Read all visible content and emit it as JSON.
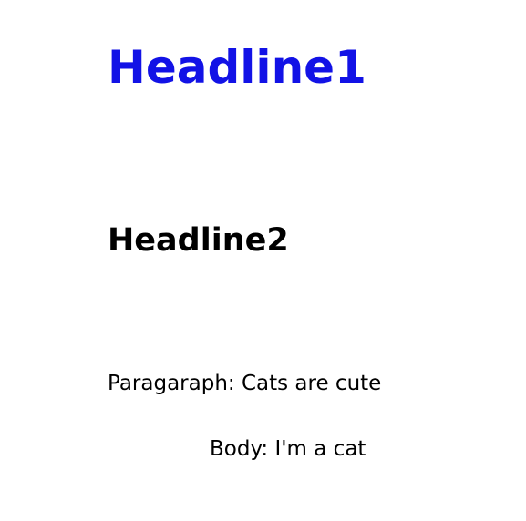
{
  "headline1": {
    "text": "Headline1",
    "color": "#1212e6"
  },
  "headline2": {
    "text": "Headline2"
  },
  "paragraph": {
    "text": "Paragaraph: Cats are cute"
  },
  "body": {
    "text": "Body: I'm a cat"
  }
}
